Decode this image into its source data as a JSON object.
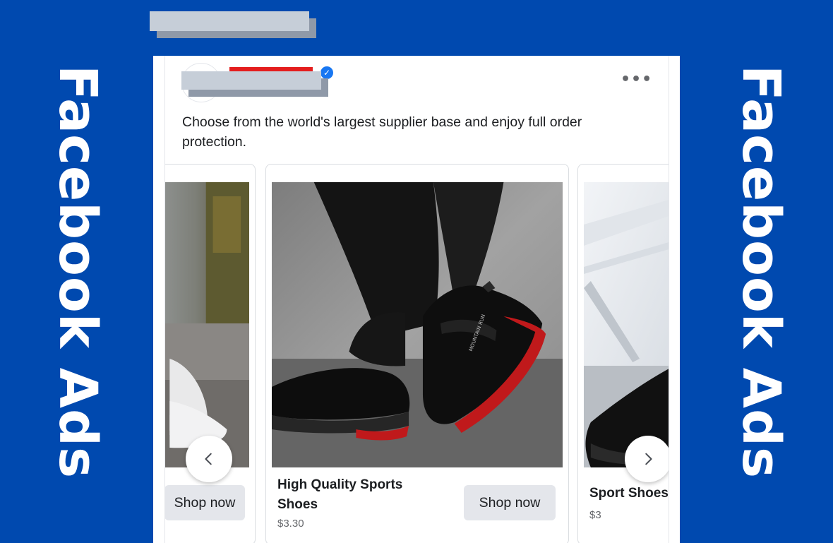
{
  "side_labels": {
    "left": "Facebook Ads",
    "right": "Facebook Ads"
  },
  "post": {
    "more_icon": "more-horizontal-icon",
    "verified_icon": "verified-badge-icon",
    "text": "Choose from the world's largest supplier base and enjoy full order protection."
  },
  "carousel": {
    "prev_icon": "chevron-left-icon",
    "next_icon": "chevron-right-icon",
    "cards": [
      {
        "cta": "Shop now"
      },
      {
        "title": "High Quality Sports Shoes",
        "price": "$3.30",
        "cta": "Shop now"
      },
      {
        "title": "Sport Shoes",
        "price": "$3"
      }
    ]
  },
  "colors": {
    "background": "#0049af",
    "verified": "#1877f2",
    "button_bg": "#e4e6eb",
    "redaction_red": "#e41e1e",
    "shoe_sole_accent": "#c0191b"
  }
}
